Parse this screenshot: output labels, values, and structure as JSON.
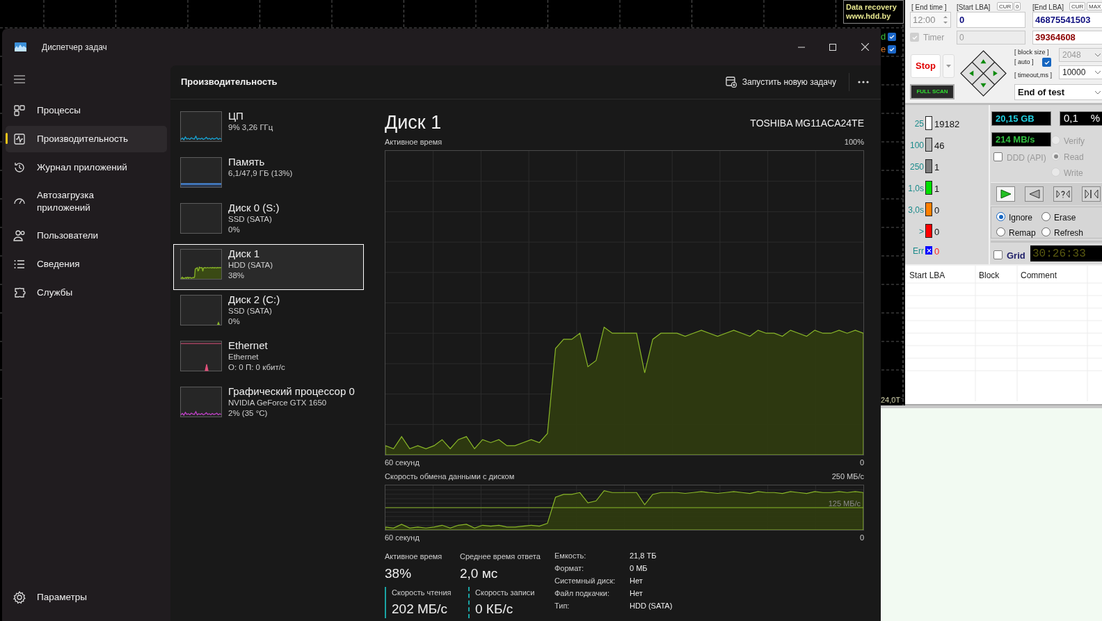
{
  "desktop": {
    "graph_label": "24,0T",
    "legend": [
      {
        "text": "d",
        "color": "#3cbf3c",
        "checked": true
      },
      {
        "text": "e",
        "color": "#d9782a",
        "checked": true
      }
    ]
  },
  "task_manager": {
    "title": "Диспетчер задач",
    "nav": [
      {
        "label": "Процессы",
        "selected": false
      },
      {
        "label": "Производительность",
        "selected": true
      },
      {
        "label": "Журнал приложений",
        "selected": false
      },
      {
        "label": "Автозагрузка приложений",
        "selected": false
      },
      {
        "label": "Пользователи",
        "selected": false
      },
      {
        "label": "Сведения",
        "selected": false
      },
      {
        "label": "Службы",
        "selected": false
      }
    ],
    "settings": "Параметры",
    "page_title": "Производительность",
    "new_task": "Запустить новую задачу",
    "devices": [
      {
        "name": "ЦП",
        "lines": [
          "9% 3,26 ГГц"
        ],
        "kind": "line",
        "color": "#17a5d6",
        "selected": false
      },
      {
        "name": "Память",
        "lines": [
          "6,1/47,9 ГБ (13%)"
        ],
        "kind": "flat",
        "color": "#4a8fe8",
        "selected": false
      },
      {
        "name": "Диск 0 (S:)",
        "lines": [
          "SSD (SATA)",
          "0%"
        ],
        "kind": "idle",
        "selected": false
      },
      {
        "name": "Диск 1",
        "lines": [
          "HDD (SATA)",
          "38%"
        ],
        "kind": "area",
        "color": "#8ab828",
        "selected": true
      },
      {
        "name": "Диск 2 (C:)",
        "lines": [
          "SSD (SATA)",
          "0%"
        ],
        "kind": "blip",
        "color": "#8ab828",
        "selected": false
      },
      {
        "name": "Ethernet",
        "lines": [
          "Ethernet",
          "О: 0 П: 0 кбит/с"
        ],
        "kind": "net",
        "color": "#e0507a",
        "selected": false
      },
      {
        "name": "Графический процессор 0",
        "lines": [
          "NVIDIA GeForce GTX 1650",
          "2% (35 °C)"
        ],
        "kind": "line",
        "color": "#c040c8",
        "selected": false
      }
    ],
    "detail": {
      "title": "Диск 1",
      "model": "TOSHIBA MG11ACA24TE",
      "active_chart": {
        "label": "Активное время",
        "max": "100%",
        "x_start": "60 секунд",
        "x_end": "0"
      },
      "transfer_chart": {
        "label": "Скорость обмена данными с диском",
        "max": "250 МБ/с",
        "mid": "125 МБ/с",
        "x_start": "60 секунд",
        "x_end": "0"
      },
      "stats": [
        {
          "label": "Активное время",
          "value": "38%",
          "kind": "plain"
        },
        {
          "label": "Среднее время ответа",
          "value": "2,0 мс",
          "kind": "plain"
        },
        {
          "label": "Скорость чтения",
          "value": "202 МБ/с",
          "kind": "read"
        },
        {
          "label": "Скорость записи",
          "value": "0 КБ/с",
          "kind": "write"
        }
      ],
      "properties": [
        {
          "label": "Емкость:",
          "value": "21,8 ТБ"
        },
        {
          "label": "Формат:",
          "value": "0 МБ"
        },
        {
          "label": "Системный диск:",
          "value": "Нет"
        },
        {
          "label": "Файл подкачки:",
          "value": "Нет"
        },
        {
          "label": "Тип:",
          "value": "HDD (SATA)"
        }
      ]
    }
  },
  "victoria": {
    "logo": [
      "Data recovery",
      "www.hdd.by"
    ],
    "end_time": {
      "label": "[ End time ]",
      "value": "12:00",
      "disabled": true
    },
    "start_lba": {
      "label": "[Start LBA]",
      "cur": "CUR",
      "cur_value": "0",
      "value": "0",
      "current": "0"
    },
    "end_lba": {
      "label": "[End LBA]",
      "cur": "CUR",
      "max": "MAX",
      "value": "46875541503",
      "current": "39364608"
    },
    "timer": {
      "label": "Timer",
      "checked": true,
      "disabled": true
    },
    "stop": "Stop",
    "full_scan": "FULL SCAN",
    "block_size": {
      "label": "[ block size ]",
      "value": "2048"
    },
    "auto": {
      "label": "[ auto ]",
      "checked": true
    },
    "timeout": {
      "label": "[ timeout,ms ]",
      "value": "10000"
    },
    "end_action": "End of test",
    "counters": [
      {
        "label": "25",
        "count": "19182",
        "color": "#ffffff",
        "kind": "bar"
      },
      {
        "label": "100",
        "count": "46",
        "color": "#b4b4b4",
        "kind": "bar"
      },
      {
        "label": "250",
        "count": "1",
        "color": "#7c7c7c",
        "kind": "bar"
      },
      {
        "label": "1,0s",
        "count": "1",
        "color": "#00e000",
        "kind": "bar"
      },
      {
        "label": "3,0s",
        "count": "0",
        "color": "#ff8000",
        "kind": "bar"
      },
      {
        "label": ">",
        "count": "0",
        "color": "#ff0000",
        "kind": "bar"
      },
      {
        "label": "Err",
        "count": "0",
        "color": "#0000ff",
        "kind": "err"
      }
    ],
    "position": "20,15 GB",
    "speed": "214 MB/s",
    "percent": "0,1",
    "percent_unit": "%",
    "ddd": {
      "label": "DDD (API)",
      "checked": false
    },
    "modes": [
      {
        "label": "Verify",
        "selected": false,
        "disabled": true
      },
      {
        "label": "Read",
        "selected": true,
        "disabled": true
      },
      {
        "label": "Write",
        "selected": false,
        "disabled": true
      }
    ],
    "actions": [
      {
        "label": "Ignore",
        "selected": true
      },
      {
        "label": "Erase",
        "selected": false
      },
      {
        "label": "Remap",
        "selected": false
      },
      {
        "label": "Refresh",
        "selected": false
      }
    ],
    "grid": {
      "label": "Grid",
      "checked": false
    },
    "elapsed": "30:26:33",
    "table": {
      "columns": [
        "Start LBA",
        "Block",
        "Comment"
      ]
    }
  }
}
